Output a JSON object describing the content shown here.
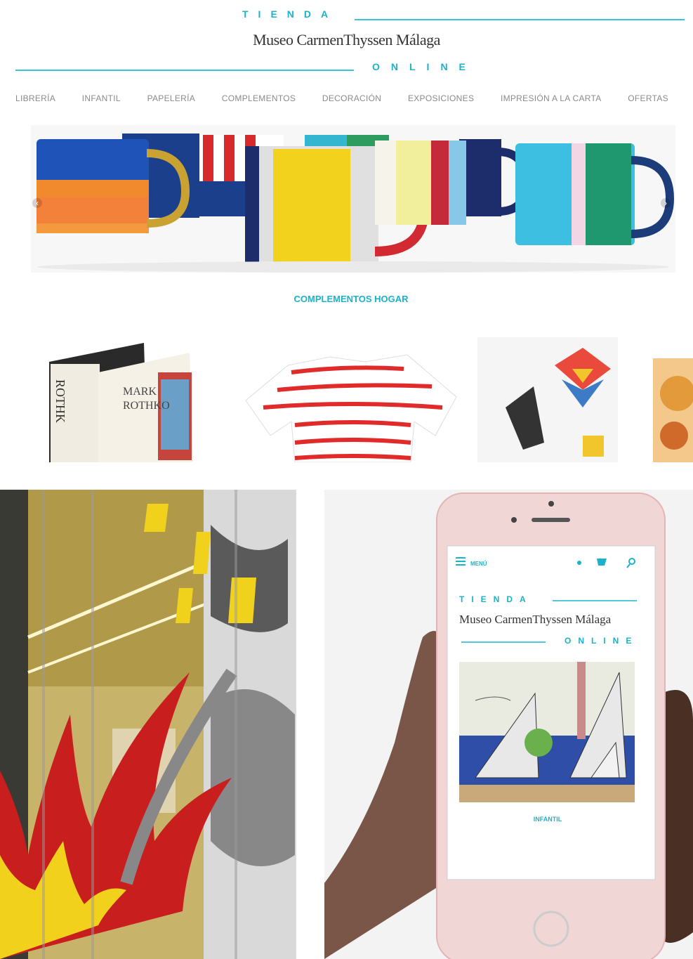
{
  "header": {
    "tienda": "TIENDA",
    "brand": "Museo CarmenThyssen Málaga",
    "online": "ONLINE"
  },
  "nav": {
    "items": [
      {
        "label": "LIBRERÍA"
      },
      {
        "label": "INFANTIL"
      },
      {
        "label": "PAPELERÍA"
      },
      {
        "label": "COMPLEMENTOS"
      },
      {
        "label": "DECORACIÓN"
      },
      {
        "label": "EXPOSICIONES"
      },
      {
        "label": "IMPRESIÓN A LA CARTA"
      },
      {
        "label": "OFERTAS"
      }
    ]
  },
  "hero": {
    "caption": "COMPLEMENTOS HOGAR",
    "prev_icon": "chevron-left-icon",
    "next_icon": "chevron-right-icon"
  },
  "products": {
    "book_author_top": "MARK",
    "book_author_bottom": "ROTHKO",
    "book_spine": "ROTHK"
  },
  "phone_screen": {
    "menu_label": "MENÚ",
    "tienda": "TIENDA",
    "brand": "Museo CarmenThyssen Málaga",
    "online": "ONLINE",
    "caption": "INFANTIL"
  },
  "colors": {
    "accent": "#1bb3c9",
    "nav_text": "#8a8a8a"
  }
}
